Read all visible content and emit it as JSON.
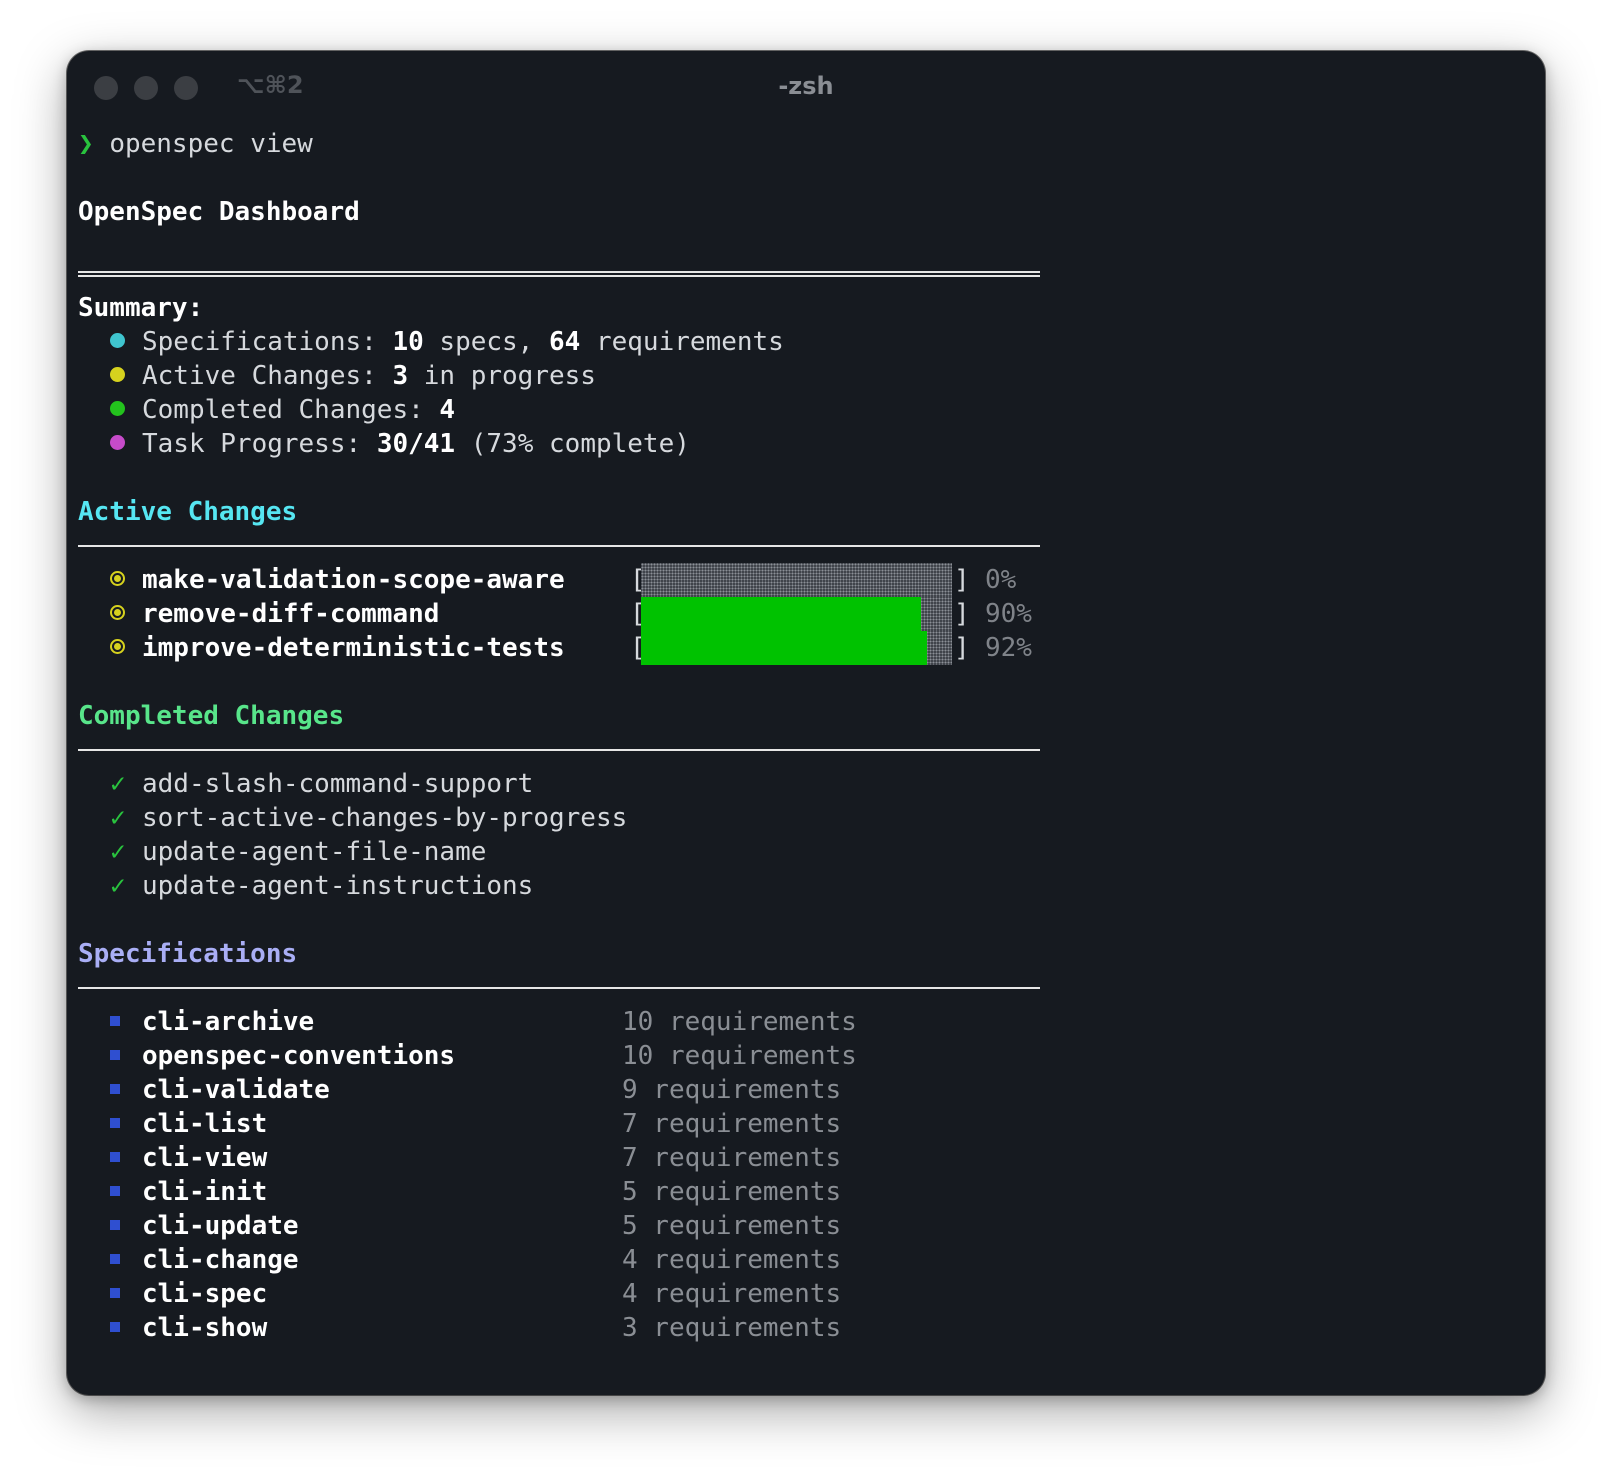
{
  "window": {
    "shortcut": "⌥⌘2",
    "title": "-zsh"
  },
  "prompt": {
    "symbol": "❯",
    "command": "openspec view"
  },
  "dashboard": {
    "title": "OpenSpec Dashboard"
  },
  "summary": {
    "label": "Summary:",
    "items": [
      {
        "dot_color": "#3fc5cf",
        "label": "Specifications: ",
        "bold1": "10",
        "mid": " specs, ",
        "bold2": "64",
        "tail": " requirements"
      },
      {
        "dot_color": "#d6d21e",
        "label": "Active Changes: ",
        "bold1": "3",
        "mid": " in progress",
        "bold2": "",
        "tail": ""
      },
      {
        "dot_color": "#23c21d",
        "label": "Completed Changes: ",
        "bold1": "4",
        "mid": "",
        "bold2": "",
        "tail": ""
      },
      {
        "dot_color": "#c64bc9",
        "label": "Task Progress: ",
        "bold1": "30/41",
        "mid": " (73% complete)",
        "bold2": "",
        "tail": ""
      }
    ]
  },
  "active_changes": {
    "heading": "Active Changes",
    "items": [
      {
        "name": "make-validation-scope-aware",
        "progress": 0,
        "percent_label": "0%"
      },
      {
        "name": "remove-diff-command",
        "progress": 0.9,
        "percent_label": "90%"
      },
      {
        "name": "improve-deterministic-tests",
        "progress": 0.92,
        "percent_label": "92%"
      }
    ],
    "bracket_open": "[",
    "bracket_close": "]"
  },
  "completed_changes": {
    "heading": "Completed Changes",
    "check": "✓",
    "items": [
      "add-slash-command-support",
      "sort-active-changes-by-progress",
      "update-agent-file-name",
      "update-agent-instructions"
    ]
  },
  "specifications": {
    "heading": "Specifications",
    "items": [
      {
        "name": "cli-archive",
        "requirements": "10 requirements"
      },
      {
        "name": "openspec-conventions",
        "requirements": "10 requirements"
      },
      {
        "name": "cli-validate",
        "requirements": "9 requirements"
      },
      {
        "name": "cli-list",
        "requirements": "7 requirements"
      },
      {
        "name": "cli-view",
        "requirements": "7 requirements"
      },
      {
        "name": "cli-init",
        "requirements": "5 requirements"
      },
      {
        "name": "cli-update",
        "requirements": "5 requirements"
      },
      {
        "name": "cli-change",
        "requirements": "4 requirements"
      },
      {
        "name": "cli-spec",
        "requirements": "4 requirements"
      },
      {
        "name": "cli-show",
        "requirements": "3 requirements"
      }
    ]
  }
}
